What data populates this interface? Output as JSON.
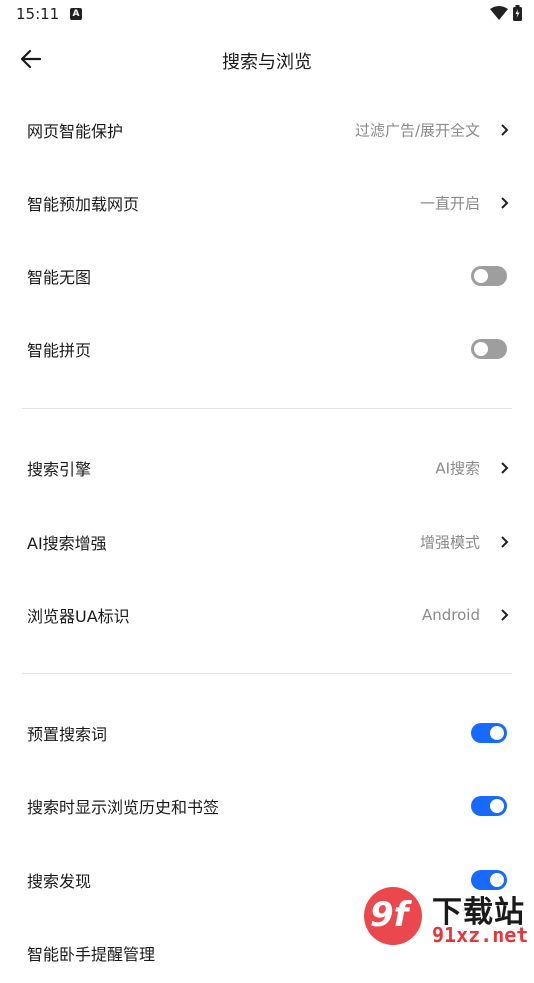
{
  "status_bar": {
    "time": "15:11",
    "notification_badge": "A"
  },
  "header": {
    "title": "搜索与浏览",
    "back_icon": "arrow-left-icon"
  },
  "section1": [
    {
      "label": "网页智能保护",
      "value": "过滤广告/展开全文",
      "kind": "nav"
    },
    {
      "label": "智能预加载网页",
      "value": "一直开启",
      "kind": "nav"
    },
    {
      "label": "智能无图",
      "kind": "toggle",
      "on": false
    },
    {
      "label": "智能拼页",
      "kind": "toggle",
      "on": false
    }
  ],
  "section2": [
    {
      "label": "搜索引擎",
      "value": "AI搜索",
      "kind": "nav"
    },
    {
      "label": "AI搜索增强",
      "value": "增强模式",
      "kind": "nav"
    },
    {
      "label": "浏览器UA标识",
      "value": "Android",
      "kind": "nav"
    }
  ],
  "section3": [
    {
      "label": "预置搜索词",
      "kind": "toggle",
      "on": true
    },
    {
      "label": "搜索时显示浏览历史和书签",
      "kind": "toggle",
      "on": true
    },
    {
      "label": "搜索发现",
      "kind": "toggle",
      "on": true
    },
    {
      "label": "智能卧手提醒管理",
      "kind": "nav"
    }
  ],
  "watermark": {
    "logo": "9f",
    "brand": "下载站",
    "url": "91xz.net"
  },
  "colors": {
    "accent": "#1769ff",
    "toggle_off": "#9e9e9e",
    "value_text": "#8a8a8a",
    "divider": "#e4e4e4"
  }
}
